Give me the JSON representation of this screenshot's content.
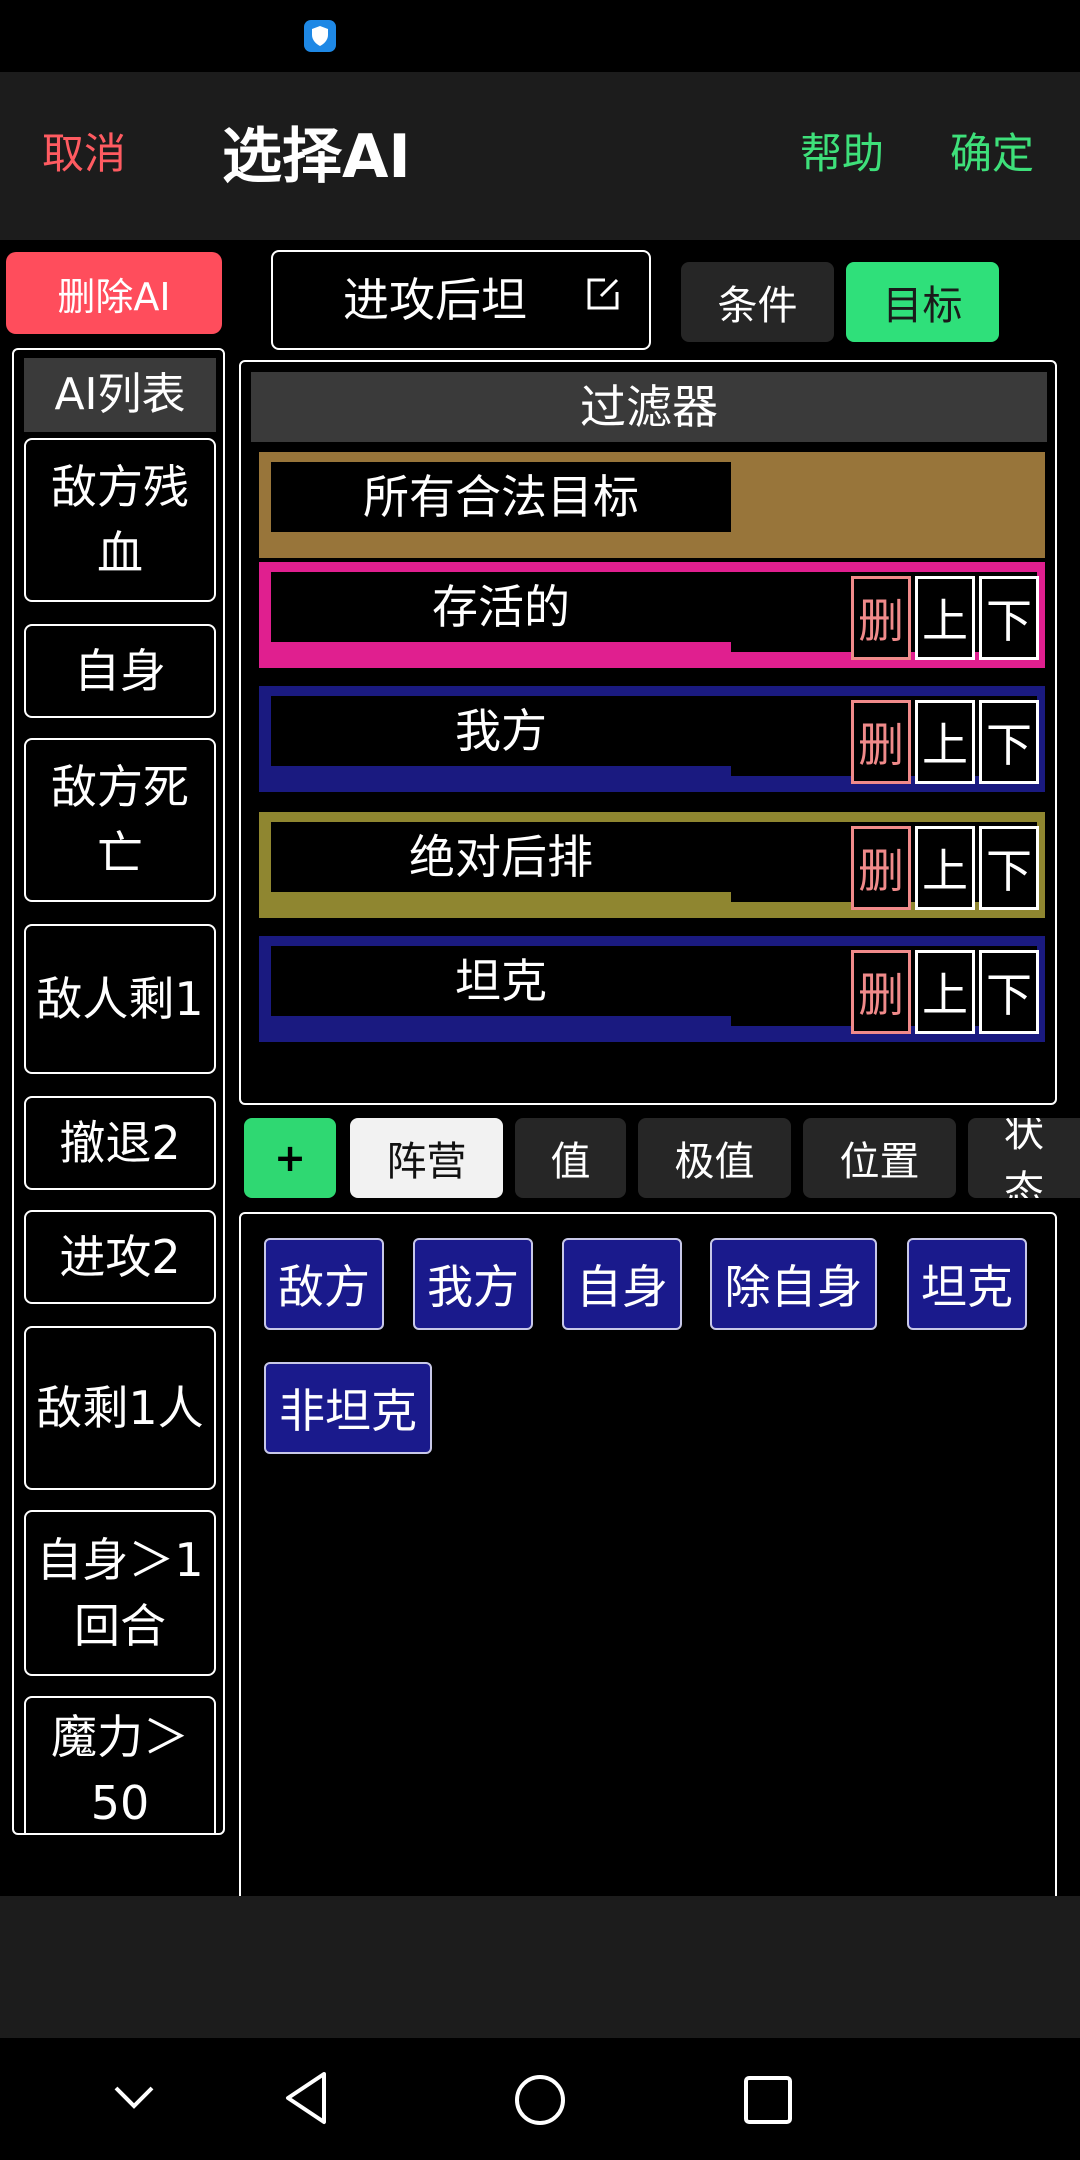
{
  "header": {
    "cancel_label": "取消",
    "title": "选择AI",
    "help_label": "帮助",
    "confirm_label": "确定"
  },
  "sidebar": {
    "delete_label": "删除AI",
    "list_title": "AI列表",
    "items": [
      "敌方残血",
      "自身",
      "敌方死亡",
      "敌人剩1",
      "撤退2",
      "进攻2",
      "敌剩1人",
      "自身＞1回合",
      "魔力＞50"
    ]
  },
  "editor": {
    "ai_name": "进攻后坦",
    "tabs": {
      "condition": "条件",
      "target": "目标"
    }
  },
  "filter": {
    "title": "过滤器",
    "rows": [
      {
        "label": "所有合法目标",
        "color": "#98753a",
        "removable": false
      },
      {
        "label": "存活的",
        "color": "#e01f8f",
        "removable": true
      },
      {
        "label": "我方",
        "color": "#1a1a80",
        "removable": true
      },
      {
        "label": "绝对后排",
        "color": "#8f8630",
        "removable": true
      },
      {
        "label": "坦克",
        "color": "#1a1a80",
        "removable": true
      }
    ],
    "delete_label": "删",
    "up_label": "上",
    "down_label": "下"
  },
  "categories": {
    "add_label": "+",
    "tabs": [
      "阵营",
      "值",
      "极值",
      "位置",
      "状态"
    ],
    "selected": "阵营"
  },
  "options": [
    "敌方",
    "我方",
    "自身",
    "除自身",
    "坦克",
    "非坦克"
  ]
}
